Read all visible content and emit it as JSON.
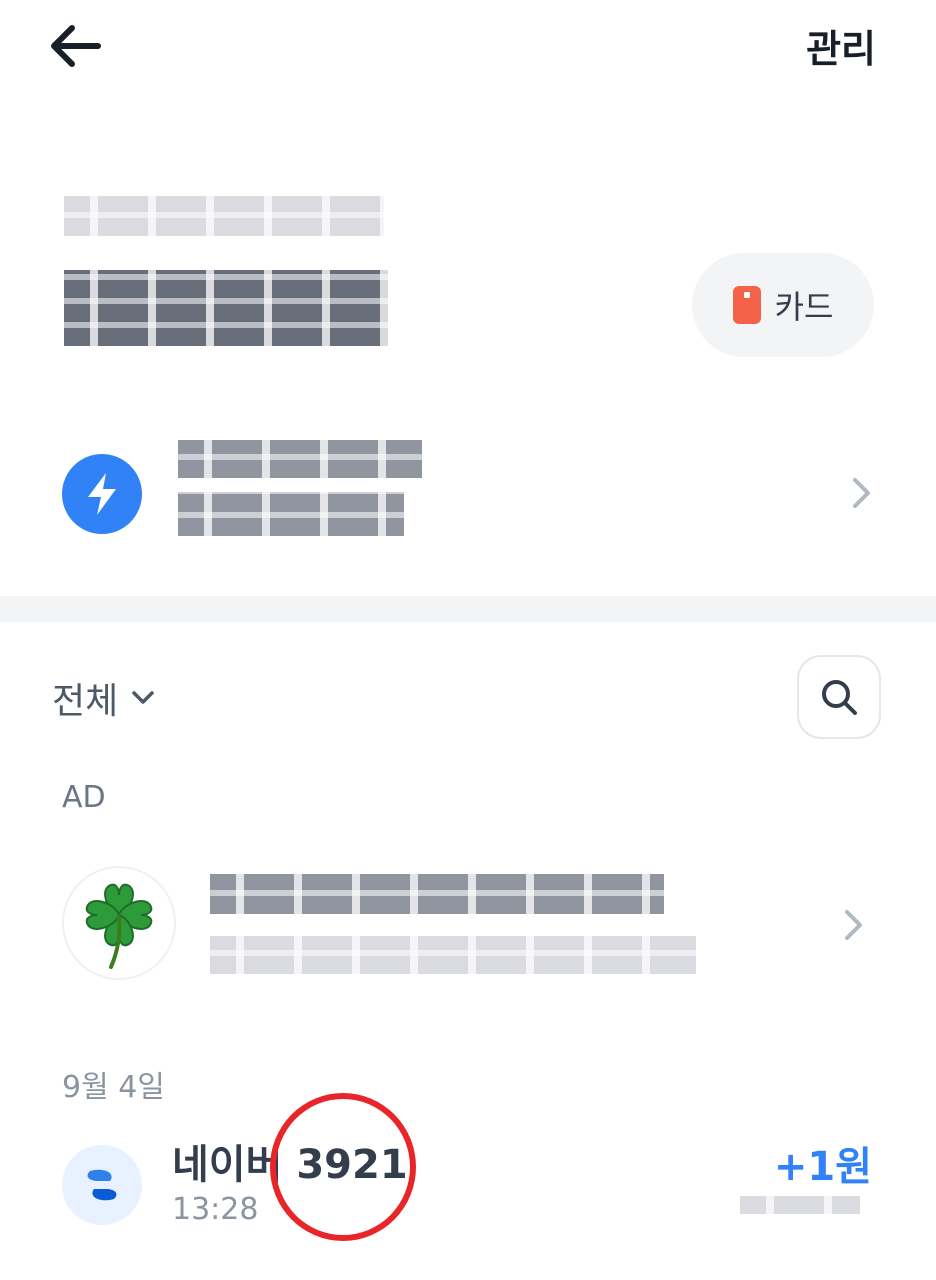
{
  "header": {
    "back_icon": "arrow-left-icon",
    "manage_label": "관리"
  },
  "account": {
    "card_button_label": "카드",
    "card_icon": "card-icon",
    "accent_color": "#f4624a"
  },
  "promo": {
    "icon": "lightning-icon",
    "icon_color": "#3182f6"
  },
  "filter": {
    "label": "전체",
    "search_icon": "search-icon"
  },
  "ad": {
    "label": "AD",
    "icon": "four-leaf-clover-icon"
  },
  "transactions": {
    "date": "9월 4일",
    "items": [
      {
        "title": "네이버 3921",
        "time": "13:28",
        "amount": "+1원",
        "amount_color": "#3182f6"
      }
    ]
  }
}
